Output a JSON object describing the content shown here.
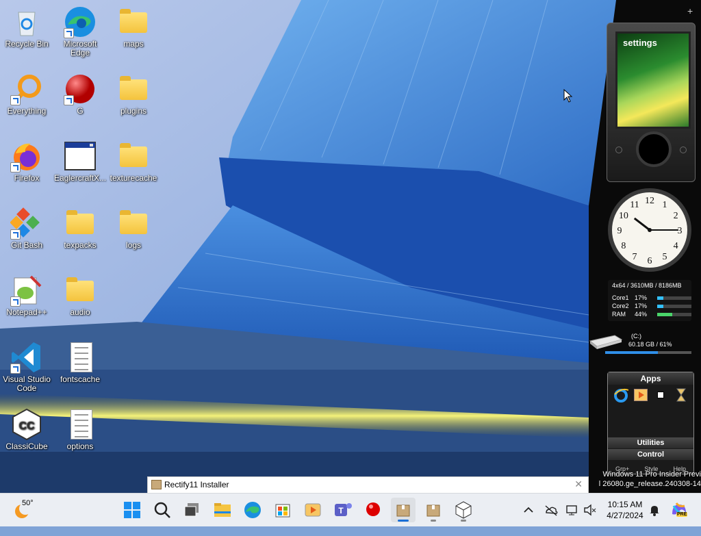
{
  "desktop_icons": [
    {
      "label": "Recycle Bin"
    },
    {
      "label": "Microsoft Edge"
    },
    {
      "label": "maps"
    },
    {
      "label": "Everything"
    },
    {
      "label": "G"
    },
    {
      "label": "plugins"
    },
    {
      "label": "Firefox"
    },
    {
      "label": "EaglercraftX..."
    },
    {
      "label": "texturecache"
    },
    {
      "label": "Git Bash"
    },
    {
      "label": "texpacks"
    },
    {
      "label": "logs"
    },
    {
      "label": "Notepad++"
    },
    {
      "label": "audio"
    },
    {
      "label": "Visual Studio Code"
    },
    {
      "label": "fontscache"
    },
    {
      "label": "ClassiCube"
    },
    {
      "label": "options"
    }
  ],
  "gadgets": {
    "plus": "+",
    "zune_label": "settings",
    "clock": {
      "hour": 10,
      "minute": 15,
      "numbers": [
        "12",
        "1",
        "2",
        "3",
        "4",
        "5",
        "6",
        "7",
        "8",
        "9",
        "10",
        "11"
      ]
    },
    "meter": {
      "header": "4x64 / 3610MB / 8186MB",
      "rows": [
        {
          "name": "Core1",
          "value": "17%",
          "level": 0.17
        },
        {
          "name": "Core2",
          "value": "17%",
          "level": 0.17
        },
        {
          "name": "RAM",
          "value": "44%",
          "level": 0.44
        }
      ]
    },
    "drive": {
      "name": "(C:)",
      "info": "60.18 GB / 61%",
      "level": 0.61
    },
    "apps": {
      "title": "Apps",
      "utilities": "Utilities",
      "control": "Control",
      "footer": [
        "Grp+",
        "Style",
        "Help"
      ]
    }
  },
  "version_watermark": {
    "line1": "Windows 11 Pro Insider Previ",
    "line2": "l 26080.ge_release.240308-14"
  },
  "installer_bar": {
    "title": "Rectify11 Installer",
    "close": "✕"
  },
  "taskbar": {
    "weather_temp": "50°",
    "pinned": [
      "start-icon",
      "search-icon",
      "task-view-icon",
      "file-explorer-icon",
      "edge-icon",
      "store-icon",
      "media-player-icon",
      "teams-icon",
      "red-ball-icon",
      "installer-icon",
      "package-icon",
      "cube-icon"
    ],
    "time": "10:15 AM",
    "date": "4/27/2024",
    "copilot_badge": "PRE"
  }
}
